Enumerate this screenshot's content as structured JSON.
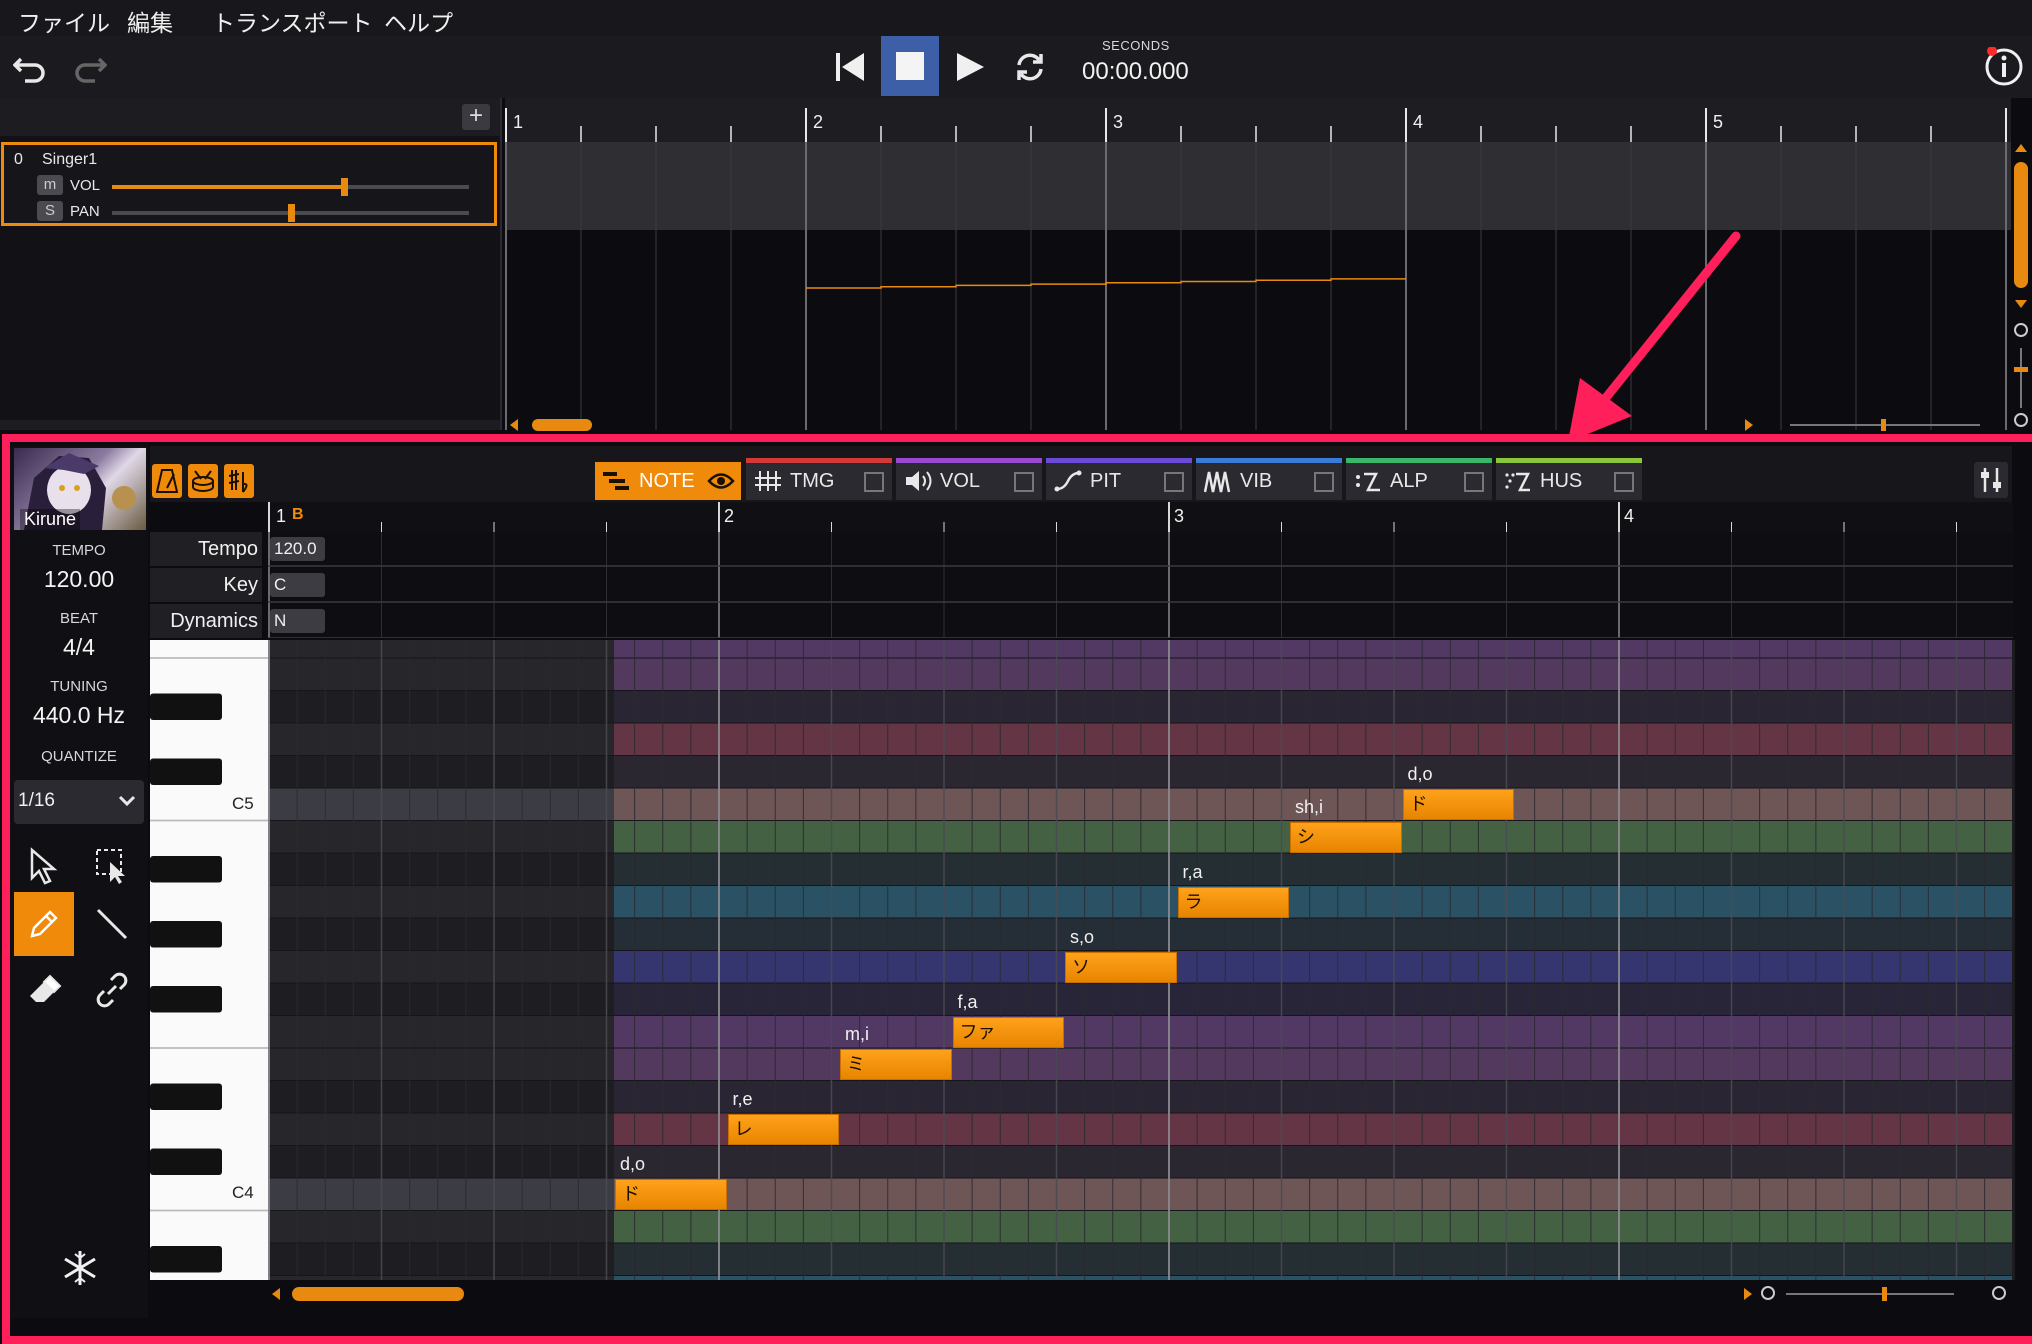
{
  "menu": {
    "items": [
      "ファイル",
      "編集",
      "トランスポート",
      "ヘルプ"
    ]
  },
  "transport": {
    "seconds_label": "SECONDS",
    "time": "00:00.000"
  },
  "track": {
    "index": "0",
    "name": "Singer1",
    "mute": "m",
    "solo": "S",
    "vol_label": "VOL",
    "pan_label": "PAN",
    "volume": 0.65,
    "pan": 0.5
  },
  "arrangement": {
    "measures": [
      "1",
      "2",
      "3",
      "4",
      "5"
    ]
  },
  "singer": {
    "name": "Kirune"
  },
  "info": {
    "tempo_label": "TEMPO",
    "tempo": "120.00",
    "beat_label": "BEAT",
    "beat": "4/4",
    "tuning_label": "TUNING",
    "tuning": "440.0 Hz",
    "quantize_label": "QUANTIZE",
    "quantize": "1/16"
  },
  "tabs": [
    {
      "label": "NOTE",
      "color": "#f08a0a"
    },
    {
      "label": "TMG",
      "color": "#d23a3a"
    },
    {
      "label": "VOL",
      "color": "#9a4ad0"
    },
    {
      "label": "PIT",
      "color": "#6a4ad8"
    },
    {
      "label": "VIB",
      "color": "#3a7ad8"
    },
    {
      "label": "ALP",
      "color": "#3ab86a"
    },
    {
      "label": "HUS",
      "color": "#8ac83a"
    }
  ],
  "ruler": {
    "measures": [
      "1",
      "2",
      "3",
      "4"
    ],
    "first_marker": "B"
  },
  "params": {
    "tempo_label": "Tempo",
    "tempo_value": "120.0",
    "key_label": "Key",
    "key_value": "C",
    "dynamics_label": "Dynamics",
    "dynamics_value": "N"
  },
  "keyboard": {
    "c5": "C5",
    "c4": "C4"
  },
  "notes": [
    {
      "lyric": "ド",
      "phoneme": "d,o",
      "pitch": "C4",
      "start": 1.0,
      "length": 0.25
    },
    {
      "lyric": "レ",
      "phoneme": "r,e",
      "pitch": "D4",
      "start": 1.25,
      "length": 0.25
    },
    {
      "lyric": "ミ",
      "phoneme": "m,i",
      "pitch": "E4",
      "start": 1.5,
      "length": 0.25
    },
    {
      "lyric": "ファ",
      "phoneme": "f,a",
      "pitch": "F4",
      "start": 1.75,
      "length": 0.25
    },
    {
      "lyric": "ソ",
      "phoneme": "s,o",
      "pitch": "G4",
      "start": 2.0,
      "length": 0.25
    },
    {
      "lyric": "ラ",
      "phoneme": "r,a",
      "pitch": "A4",
      "start": 2.25,
      "length": 0.25
    },
    {
      "lyric": "シ",
      "phoneme": "sh,i",
      "pitch": "B4",
      "start": 2.5,
      "length": 0.25
    },
    {
      "lyric": "ド",
      "phoneme": "d,o",
      "pitch": "C5",
      "start": 2.75,
      "length": 0.25
    }
  ],
  "colors": {
    "accent": "#f08a0a",
    "highlight_frame": "#ff1f5a",
    "note": "#ffa21a"
  }
}
